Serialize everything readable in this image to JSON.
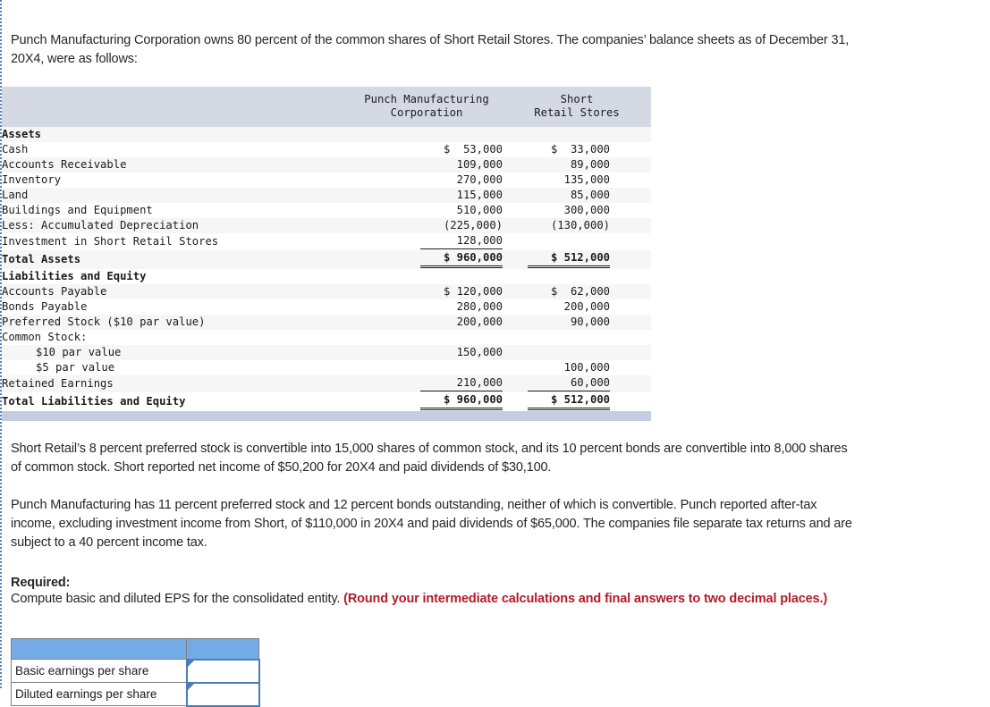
{
  "intro": "Punch Manufacturing Corporation owns 80 percent of the common shares of Short Retail Stores. The companies’ balance sheets as of December 31, 20X4, were as follows:",
  "balance_sheet": {
    "columns": [
      {
        "line1": "",
        "line2": ""
      },
      {
        "line1": "Punch Manufacturing",
        "line2": "Corporation"
      },
      {
        "line1": "Short",
        "line2": "Retail Stores"
      }
    ],
    "rows": [
      {
        "label": "Assets",
        "indent": 0,
        "bold": true,
        "section": true,
        "punch": "",
        "short": "",
        "rule": 0
      },
      {
        "label": "Cash",
        "indent": 0,
        "bold": false,
        "punch": "$  53,000",
        "short": "$  33,000",
        "rule": 0
      },
      {
        "label": "Accounts Receivable",
        "indent": 0,
        "bold": false,
        "punch": "109,000",
        "short": "89,000",
        "rule": 0
      },
      {
        "label": "Inventory",
        "indent": 0,
        "bold": false,
        "punch": "270,000",
        "short": "135,000",
        "rule": 0
      },
      {
        "label": "Land",
        "indent": 0,
        "bold": false,
        "punch": "115,000",
        "short": "85,000",
        "rule": 0
      },
      {
        "label": "Buildings and Equipment",
        "indent": 0,
        "bold": false,
        "punch": "510,000",
        "short": "300,000",
        "rule": 0
      },
      {
        "label": "Less: Accumulated Depreciation",
        "indent": 0,
        "bold": false,
        "punch": "(225,000)",
        "short": "(130,000)",
        "rule": 0
      },
      {
        "label": "Investment in Short Retail Stores",
        "indent": 0,
        "bold": false,
        "punch": "128,000",
        "short": "",
        "rule": 1
      },
      {
        "label": "Total Assets",
        "indent": 0,
        "bold": true,
        "total": true,
        "punch": "$ 960,000",
        "short": "$ 512,000",
        "rule": 2
      },
      {
        "label": "Liabilities and Equity",
        "indent": 0,
        "bold": true,
        "section": true,
        "punch": "",
        "short": "",
        "rule": 0
      },
      {
        "label": "Accounts Payable",
        "indent": 0,
        "bold": false,
        "punch": "$ 120,000",
        "short": "$  62,000",
        "rule": 0
      },
      {
        "label": "Bonds Payable",
        "indent": 0,
        "bold": false,
        "punch": "280,000",
        "short": "200,000",
        "rule": 0
      },
      {
        "label": "Preferred Stock ($10 par value)",
        "indent": 0,
        "bold": false,
        "punch": "200,000",
        "short": "90,000",
        "rule": 0
      },
      {
        "label": "Common Stock:",
        "indent": 0,
        "bold": false,
        "punch": "",
        "short": "",
        "rule": 0
      },
      {
        "label": "$10 par value",
        "indent": 1,
        "bold": false,
        "punch": "150,000",
        "short": "",
        "rule": 0
      },
      {
        "label": "$5 par value",
        "indent": 1,
        "bold": false,
        "punch": "",
        "short": "100,000",
        "rule": 0
      },
      {
        "label": "Retained Earnings",
        "indent": 0,
        "bold": false,
        "punch": "210,000",
        "short": "60,000",
        "rule": 1
      },
      {
        "label": "Total Liabilities and Equity",
        "indent": 0,
        "bold": true,
        "total": true,
        "punch": "$ 960,000",
        "short": "$ 512,000",
        "rule": 2
      }
    ]
  },
  "paragraphs": {
    "p1": "Short Retail’s 8 percent preferred stock is convertible into 15,000 shares of common stock, and its 10 percent bonds are convertible into 8,000 shares of common stock. Short reported net income of $50,200 for 20X4 and paid dividends of $30,100.",
    "p2": "Punch Manufacturing has 11 percent preferred stock and 12 percent bonds outstanding, neither of which is convertible. Punch reported after-tax income, excluding investment income from Short, of $110,000 in 20X4 and paid dividends of $65,000. The companies file separate tax returns and are subject to a 40 percent income tax."
  },
  "required": {
    "heading": "Required:",
    "body_plain": "Compute basic and diluted EPS for the consolidated entity. ",
    "body_emphasis": "(Round your intermediate calculations and final answers to two decimal places.)"
  },
  "answer_table": {
    "header_label": "",
    "rows": [
      {
        "label": "Basic earnings per share",
        "value": ""
      },
      {
        "label": "Diluted earnings per share",
        "value": ""
      }
    ]
  },
  "colors": {
    "table_header_bg": "#d4d9e4",
    "table_footer_bg": "#c6cde0",
    "row_stripe": "#f6f6f6",
    "answer_header_blue": "#74abe6",
    "answer_input_border": "#4a7ebb",
    "emphasis_red": "#b31c28",
    "rail_dotted": "#5b7fb5"
  }
}
